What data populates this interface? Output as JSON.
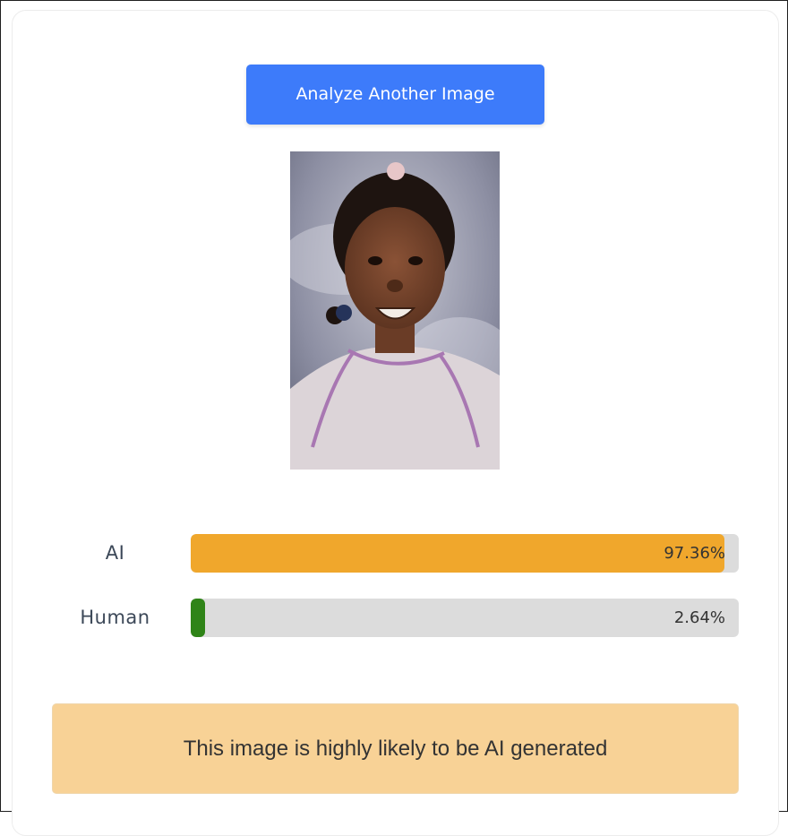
{
  "actions": {
    "analyze_another_label": "Analyze Another Image"
  },
  "image": {
    "alt": "Portrait of a smiling young girl"
  },
  "results": [
    {
      "label": "AI",
      "value_text": "97.36%",
      "percent": 97.36,
      "color": "#f0a72c"
    },
    {
      "label": "Human",
      "value_text": "2.64%",
      "percent": 2.64,
      "color": "#2f8418"
    }
  ],
  "verdict": {
    "text": "This image is highly likely to be AI generated",
    "background": "#f8d296"
  },
  "colors": {
    "primary_button": "#3d7bfa",
    "track": "#dcdcdc"
  }
}
